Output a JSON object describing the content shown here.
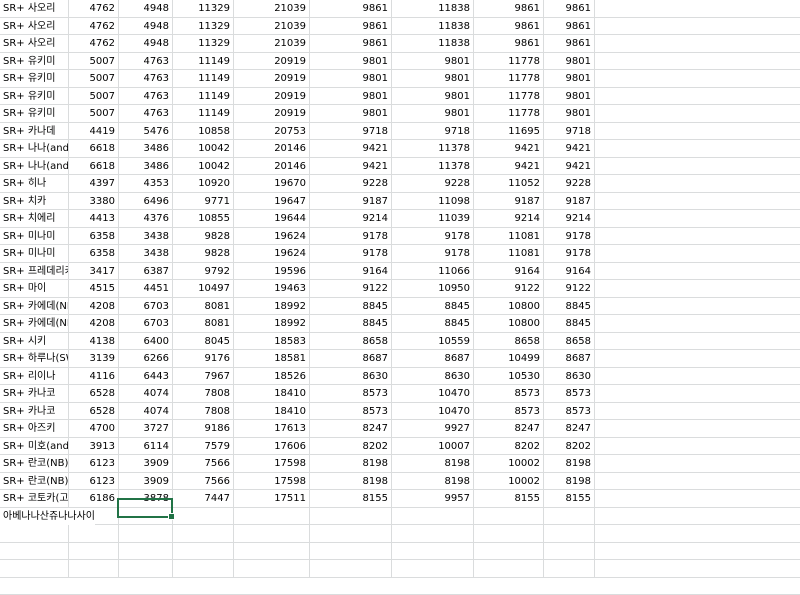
{
  "sheet": {
    "rows": [
      [
        "SR+ 사오리",
        "4762",
        "4948",
        "11329",
        "21039",
        "9861",
        "11838",
        "9861",
        "9861"
      ],
      [
        "SR+ 사오리",
        "4762",
        "4948",
        "11329",
        "21039",
        "9861",
        "11838",
        "9861",
        "9861"
      ],
      [
        "SR+ 사오리",
        "4762",
        "4948",
        "11329",
        "21039",
        "9861",
        "11838",
        "9861",
        "9861"
      ],
      [
        "SR+ 유키미",
        "5007",
        "4763",
        "11149",
        "20919",
        "9801",
        "9801",
        "11778",
        "9801"
      ],
      [
        "SR+ 유키미",
        "5007",
        "4763",
        "11149",
        "20919",
        "9801",
        "9801",
        "11778",
        "9801"
      ],
      [
        "SR+ 유키미",
        "5007",
        "4763",
        "11149",
        "20919",
        "9801",
        "9801",
        "11778",
        "9801"
      ],
      [
        "SR+ 유키미",
        "5007",
        "4763",
        "11149",
        "20919",
        "9801",
        "9801",
        "11778",
        "9801"
      ],
      [
        "SR+ 카나데",
        "4419",
        "5476",
        "10858",
        "20753",
        "9718",
        "9718",
        "11695",
        "9718"
      ],
      [
        "SR+ 나나(andr",
        "6618",
        "3486",
        "10042",
        "20146",
        "9421",
        "11378",
        "9421",
        "9421"
      ],
      [
        "SR+ 나나(andr",
        "6618",
        "3486",
        "10042",
        "20146",
        "9421",
        "11378",
        "9421",
        "9421"
      ],
      [
        "SR+ 히나",
        "4397",
        "4353",
        "10920",
        "19670",
        "9228",
        "9228",
        "11052",
        "9228"
      ],
      [
        "SR+ 치카",
        "3380",
        "6496",
        "9771",
        "19647",
        "9187",
        "11098",
        "9187",
        "9187"
      ],
      [
        "SR+ 치에리",
        "4413",
        "4376",
        "10855",
        "19644",
        "9214",
        "11039",
        "9214",
        "9214"
      ],
      [
        "SR+ 미나미",
        "6358",
        "3438",
        "9828",
        "19624",
        "9178",
        "9178",
        "11081",
        "9178"
      ],
      [
        "SR+ 미나미",
        "6358",
        "3438",
        "9828",
        "19624",
        "9178",
        "9178",
        "11081",
        "9178"
      ],
      [
        "SR+ 프레데리카",
        "3417",
        "6387",
        "9792",
        "19596",
        "9164",
        "11066",
        "9164",
        "9164"
      ],
      [
        "SR+ 마이",
        "4515",
        "4451",
        "10497",
        "19463",
        "9122",
        "10950",
        "9122",
        "9122"
      ],
      [
        "SR+ 카에데(NI",
        "4208",
        "6703",
        "8081",
        "18992",
        "8845",
        "8845",
        "10800",
        "8845"
      ],
      [
        "SR+ 카에데(NI",
        "4208",
        "6703",
        "8081",
        "18992",
        "8845",
        "8845",
        "10800",
        "8845"
      ],
      [
        "SR+ 시키",
        "4138",
        "6400",
        "8045",
        "18583",
        "8658",
        "10559",
        "8658",
        "8658"
      ],
      [
        "SR+ 하루나(SW",
        "3139",
        "6266",
        "9176",
        "18581",
        "8687",
        "8687",
        "10499",
        "8687"
      ],
      [
        "SR+ 리이나",
        "4116",
        "6443",
        "7967",
        "18526",
        "8630",
        "8630",
        "10530",
        "8630"
      ],
      [
        "SR+ 카나코",
        "6528",
        "4074",
        "7808",
        "18410",
        "8573",
        "10470",
        "8573",
        "8573"
      ],
      [
        "SR+ 카나코",
        "6528",
        "4074",
        "7808",
        "18410",
        "8573",
        "10470",
        "8573",
        "8573"
      ],
      [
        "SR+ 아즈키",
        "4700",
        "3727",
        "9186",
        "17613",
        "8247",
        "9927",
        "8247",
        "8247"
      ],
      [
        "SR+ 미호(andr",
        "3913",
        "6114",
        "7579",
        "17606",
        "8202",
        "10007",
        "8202",
        "8202"
      ],
      [
        "SR+ 란코(NB)",
        "6123",
        "3909",
        "7566",
        "17598",
        "8198",
        "8198",
        "10002",
        "8198"
      ],
      [
        "SR+ 란코(NB)",
        "6123",
        "3909",
        "7566",
        "17598",
        "8198",
        "8198",
        "10002",
        "8198"
      ],
      [
        "SR+ 코토카(고",
        "6186",
        "3878",
        "7447",
        "17511",
        "8155",
        "9957",
        "8155",
        "8155"
      ]
    ],
    "footer_text": "아베나나산쥬나나사이"
  }
}
